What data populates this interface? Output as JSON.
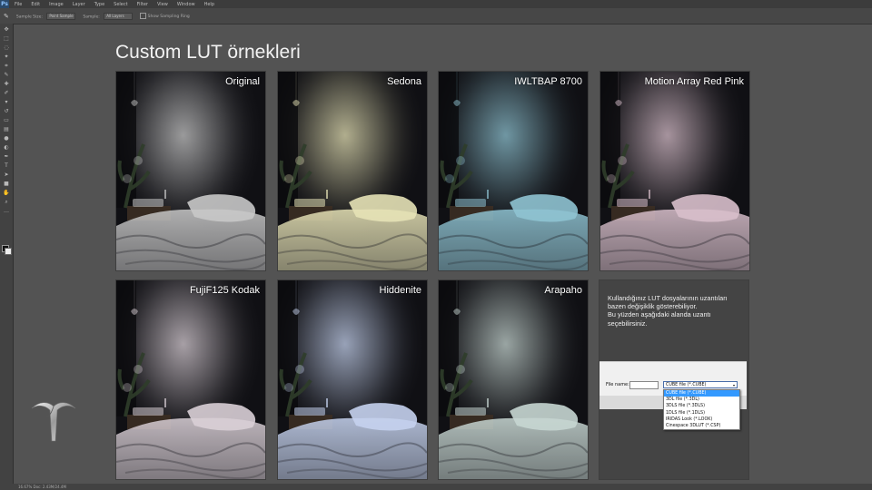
{
  "app": {
    "logo": "Ps",
    "menu": [
      "File",
      "Edit",
      "Image",
      "Layer",
      "Type",
      "Select",
      "Filter",
      "View",
      "Window",
      "Help"
    ],
    "options": [
      {
        "label": "Sample Size:",
        "value": "Point Sample"
      },
      {
        "label": "Sample:",
        "value": "All Layers"
      },
      {
        "label": "Show Sampling Ring",
        "value": ""
      }
    ],
    "status": "16.67%   Doc: 2.43M/24.4M"
  },
  "page": {
    "title": "Custom LUT örnekleri"
  },
  "panels": [
    {
      "label": "Original",
      "tint": "#c8c8c8"
    },
    {
      "label": "Sedona",
      "tint": "#e6e2b6"
    },
    {
      "label": "IWLTBAP 8700",
      "tint": "#8fc3d2"
    },
    {
      "label": "Motion Array Red Pink",
      "tint": "#d8bfcb"
    },
    {
      "label": "FujiF125 Kodak",
      "tint": "#d9cfd6"
    },
    {
      "label": "Hiddenite",
      "tint": "#c5d2ee"
    },
    {
      "label": "Arapaho",
      "tint": "#c7d6d2"
    }
  ],
  "info": {
    "line1": "Kullandığınız LUT dosyalarının uzantıları bazen değişiklik gösterebiliyor.",
    "line2": "Bu yüzden aşağıdaki alanda uzantı seçebilirsiniz."
  },
  "dialog": {
    "filename_label": "File name:",
    "filename_value": "",
    "filetype_value": "CUBE file (*.CUBE)",
    "options": [
      "CUBE file (*.CUBE)",
      "3DL file (*.3DL)",
      "3DLS file (*.3DLS)",
      "1DLS file (*.1DLS)",
      "IRIDAS Look (*.LOOK)",
      "Cinespace 3DLUT (*.CSP)"
    ],
    "selected_index": 0
  }
}
